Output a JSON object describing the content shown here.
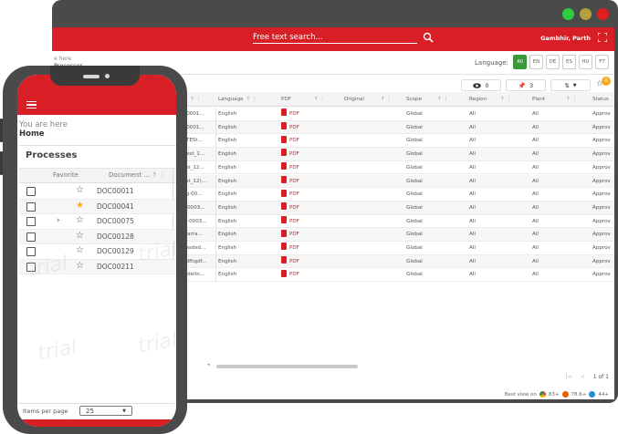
{
  "desktop": {
    "search_placeholder": "Free text search...",
    "user_name": "Gambhir, Parth",
    "breadcrumb_line1": "e here",
    "breadcrumb_line2": "Processes",
    "language_label": "Language:",
    "languages": [
      "All",
      "EN",
      "DE",
      "ES",
      "HU",
      "FT"
    ],
    "active_language": "All",
    "view_count": "0",
    "pin_count": "3",
    "star_badge": "0",
    "columns": [
      "...",
      "Language",
      "PDF",
      "Original",
      "Scope",
      "Region",
      "Plant",
      "Status"
    ],
    "rows": [
      {
        "name": "t-0001...",
        "language": "English",
        "pdf": "PDF",
        "scope": "Global",
        "region": "All",
        "plant": "All",
        "status": "Approv"
      },
      {
        "name": "t-0001...",
        "language": "English",
        "pdf": "PDF",
        "scope": "Global",
        "region": "All",
        "plant": "All",
        "status": "Approv"
      },
      {
        "name": "CTESt...",
        "language": "English",
        "pdf": "PDF",
        "scope": "Global",
        "region": "All",
        "plant": "All",
        "status": "Approv"
      },
      {
        "name": "-Test_1...",
        "language": "English",
        "pdf": "PDF",
        "scope": "Global",
        "region": "All",
        "plant": "All",
        "status": "Approv"
      },
      {
        "name": "est_12...",
        "language": "English",
        "pdf": "PDF",
        "scope": "Global",
        "region": "All",
        "plant": "All",
        "status": "Approv"
      },
      {
        "name": "est_12)...",
        "language": "English",
        "pdf": "PDF",
        "scope": "Global",
        "region": "All",
        "plant": "All",
        "status": "Approv"
      },
      {
        "name": "gg-00...",
        "language": "English",
        "pdf": "PDF",
        "scope": "Global",
        "region": "All",
        "plant": "All",
        "status": "Approv"
      },
      {
        "name": "c-0003...",
        "language": "English",
        "pdf": "PDF",
        "scope": "Global",
        "region": "All",
        "plant": "All",
        "status": "Approv"
      },
      {
        "name": "st-0003...",
        "language": "English",
        "pdf": "PDF",
        "scope": "Global",
        "region": "All",
        "plant": "All",
        "status": "Approv"
      },
      {
        "name": "Warra...",
        "language": "English",
        "pdf": "PDF",
        "scope": "Global",
        "region": "All",
        "plant": "All",
        "status": "Approv"
      },
      {
        "name": "dasdsd...",
        "language": "English",
        "pdf": "PDF",
        "scope": "Global",
        "region": "All",
        "plant": "All",
        "status": "Approv"
      },
      {
        "name": "gdfhgdf...",
        "language": "English",
        "pdf": "PDF",
        "scope": "Global",
        "region": "All",
        "plant": "All",
        "status": "Approv"
      },
      {
        "name": "uidelin...",
        "language": "English",
        "pdf": "PDF",
        "scope": "Global",
        "region": "All",
        "plant": "All",
        "status": "Approv"
      }
    ],
    "pager_text": "1 of 1",
    "footer_text": "Best view on",
    "browsers": [
      "83+",
      "78.6+",
      "44+"
    ]
  },
  "phone": {
    "you_are_here": "You are here",
    "home": "Home",
    "panel_title": "Processes",
    "col_favorite": "Favorite",
    "col_document": "Document ...",
    "rows": [
      {
        "doc": "DOC00011",
        "fav": false,
        "expand": false
      },
      {
        "doc": "DOC00041",
        "fav": true,
        "expand": false
      },
      {
        "doc": "DOC00075",
        "fav": false,
        "expand": true
      },
      {
        "doc": "DOC00128",
        "fav": false,
        "expand": false
      },
      {
        "doc": "DOC00129",
        "fav": false,
        "expand": false
      },
      {
        "doc": "DOC00211",
        "fav": false,
        "expand": false
      }
    ],
    "items_per_page_label": "Items per page",
    "items_per_page_value": "25"
  },
  "watermark": "trial",
  "colors": {
    "brand_red": "#d91f26",
    "frame": "#4a4a4a",
    "active_lang": "#3a9a3a",
    "star_fav": "#f2b21c",
    "dot_green": "#2ecc40",
    "dot_yellow": "#b5a040",
    "dot_red": "#e02020"
  }
}
